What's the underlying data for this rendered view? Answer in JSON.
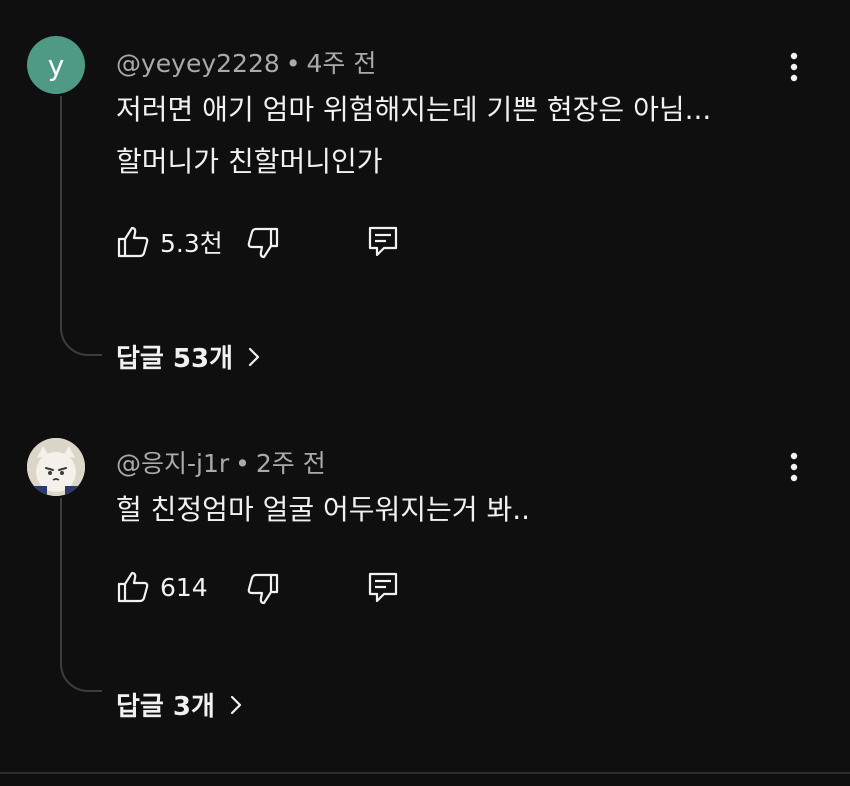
{
  "comments": [
    {
      "avatar_letter": "y",
      "avatar_color": "#4e9a85",
      "username": "@yeyey2228",
      "separator": "•",
      "time": "4주 전",
      "lines": [
        "저러면 애기 엄마 위험해지는데 기쁜 현장은 아님...",
        "할머니가 친할머니인가"
      ],
      "like_count": "5.3천",
      "replies_label": "답글 53개",
      "icons": [
        "like-icon",
        "dislike-icon",
        "reply-icon",
        "more-vert-icon",
        "chevron-right-icon"
      ]
    },
    {
      "avatar_description": "character-avatar",
      "username": "@응지-j1r",
      "separator": "•",
      "time": "2주 전",
      "lines": [
        "헐 친정엄마 얼굴 어두워지는거 봐.."
      ],
      "like_count": "614",
      "replies_label": "답글 3개",
      "icons": [
        "like-icon",
        "dislike-icon",
        "reply-icon",
        "more-vert-icon",
        "chevron-right-icon"
      ]
    }
  ],
  "colors": {
    "background": "#0f0f0f",
    "text": "#f1f1f1",
    "meta_text": "#aaaaaa",
    "thread_line": "#3d3d3d"
  }
}
